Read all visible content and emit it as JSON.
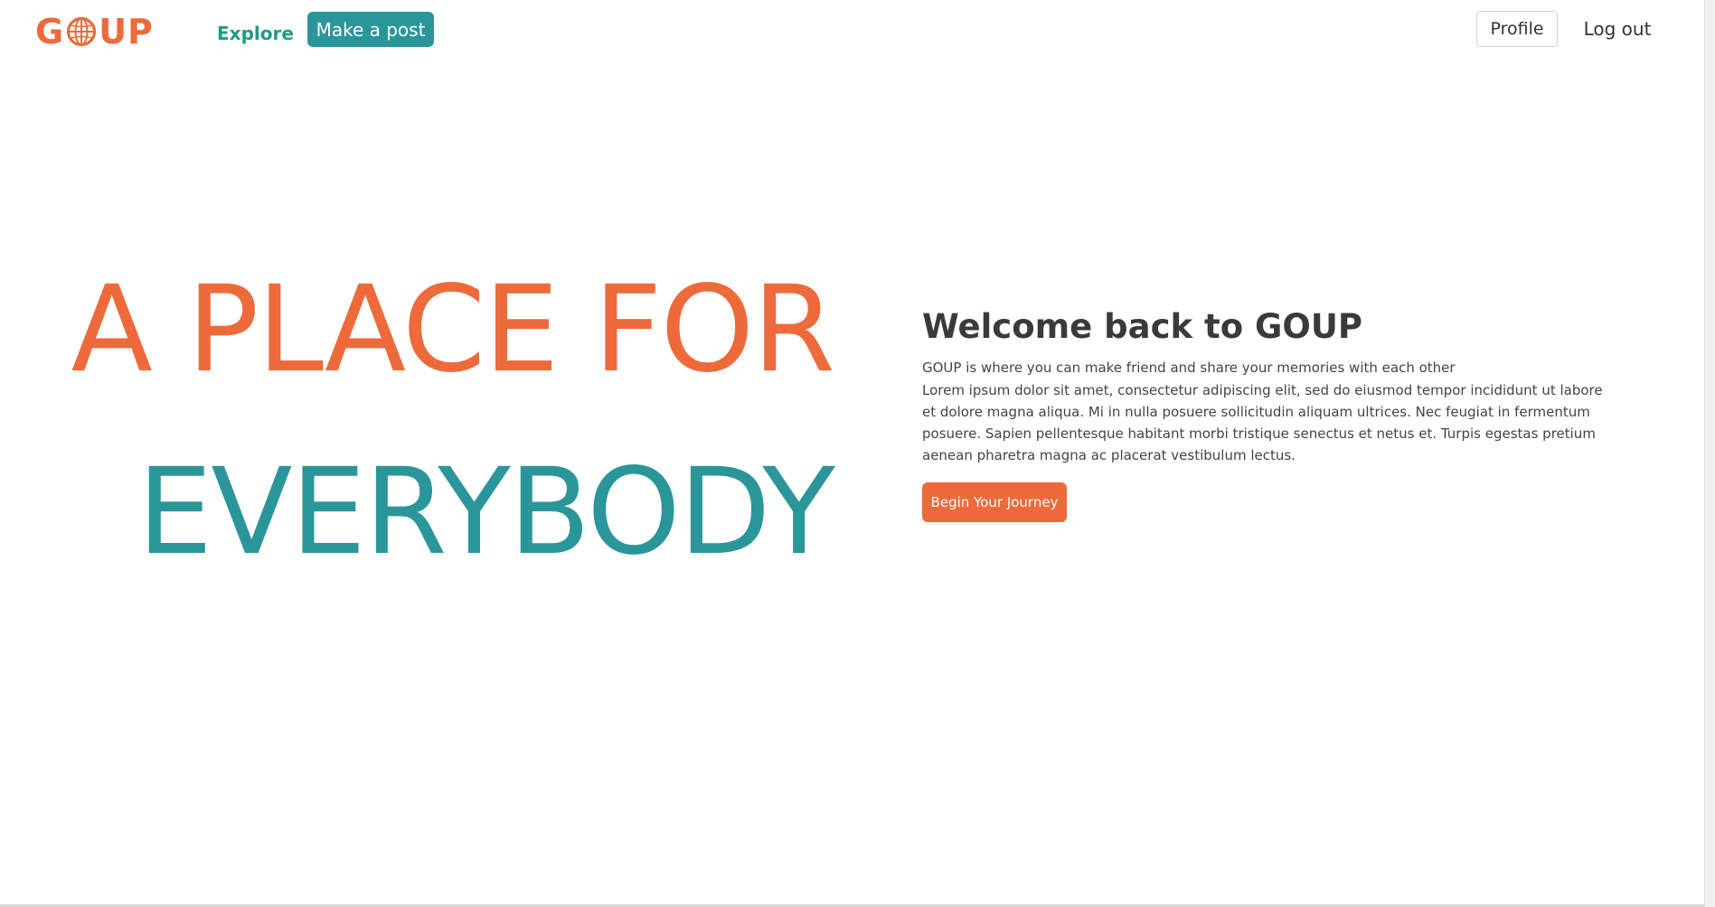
{
  "navbar": {
    "logo_text_left": "G",
    "logo_text_right": "UP",
    "explore_label": "Explore",
    "make_post_label": "Make a post",
    "profile_label": "Profile",
    "logout_label": "Log out"
  },
  "hero": {
    "line1": "A PLACE FOR",
    "line2": "EVERYBODY",
    "welcome_title": "Welcome back to GOUP",
    "tagline": "GOUP is where you can make friend and share your memories with each other",
    "lorem": "Lorem ipsum dolor sit amet, consectetur adipiscing elit, sed do eiusmod tempor incididunt ut labore et dolore magna aliqua. Mi in nulla posuere sollicitudin aliquam ultrices. Nec feugiat in fermentum posuere. Sapien pellentesque habitant morbi tristique senectus et netus et. Turpis egestas pretium aenean pharetra magna ac placerat vestibulum lectus.",
    "cta_label": "Begin Your Journey"
  },
  "colors": {
    "brand_orange": "#ee6a3b",
    "brand_teal": "#2b969a",
    "explore_green": "#1f9a86",
    "text_dark": "#3a3a3a"
  },
  "icons": {
    "logo_globe": "globe-icon"
  }
}
